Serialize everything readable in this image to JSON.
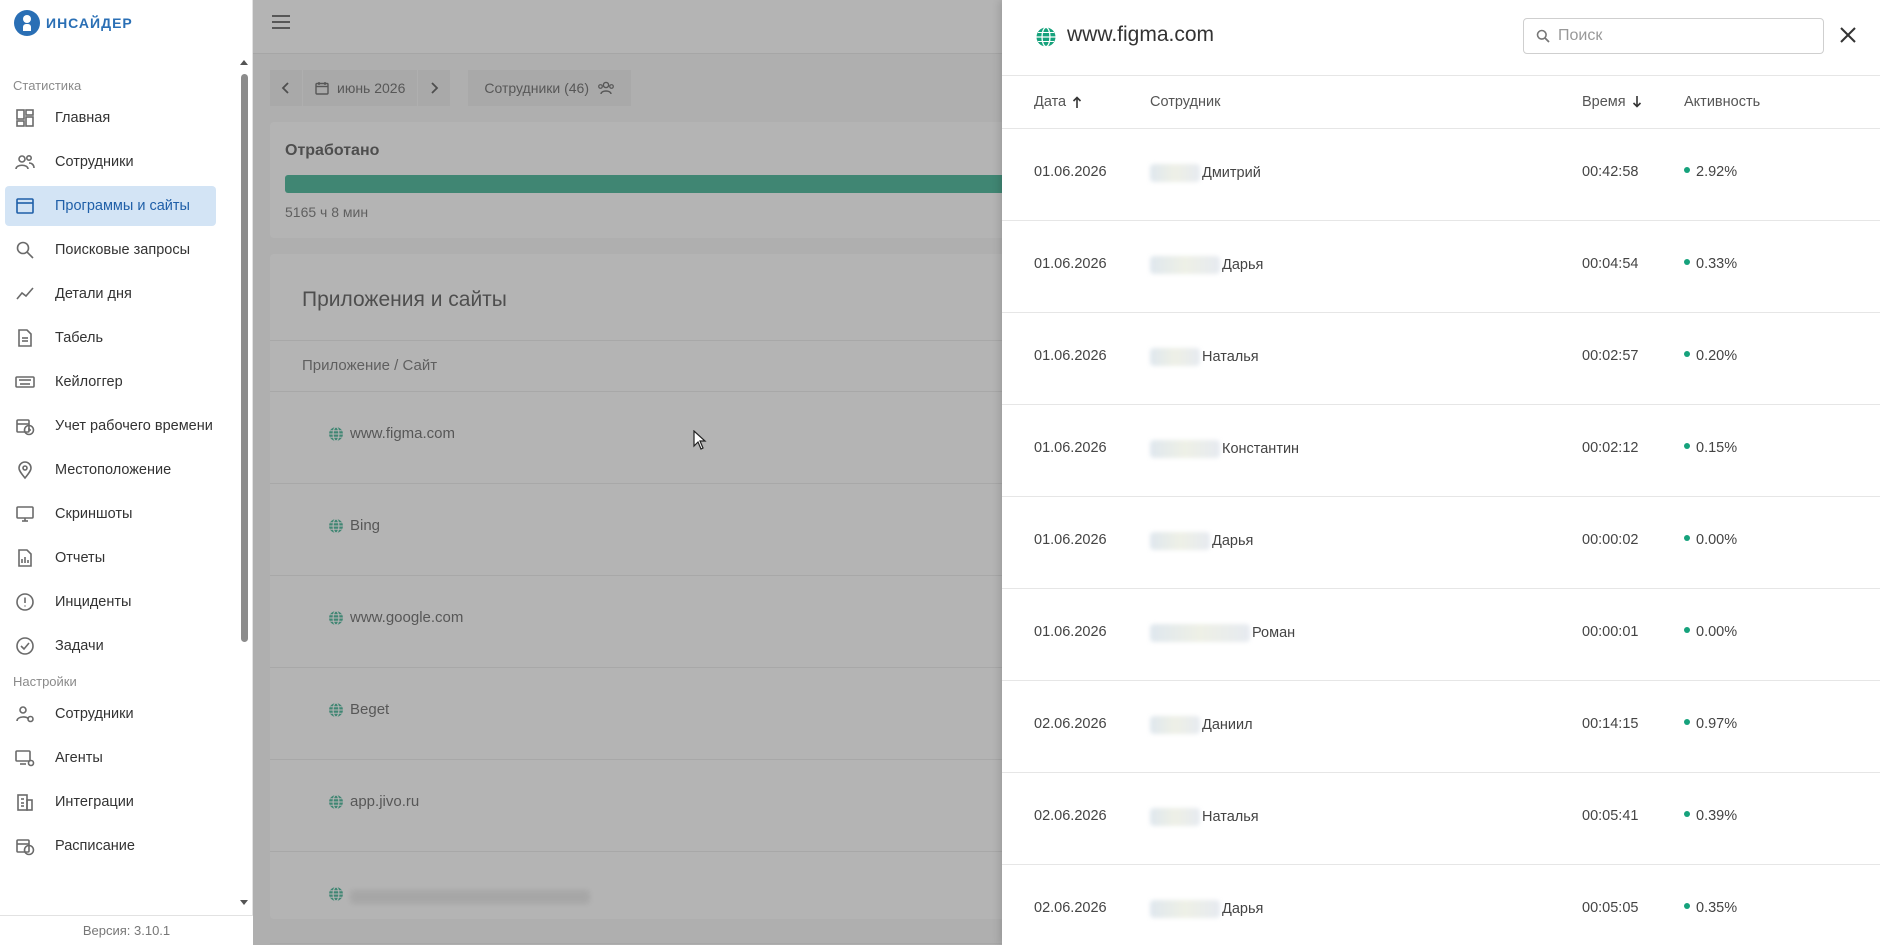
{
  "app": {
    "logo_text": "ИНСАЙДЕР",
    "version": "Версия: 3.10.1"
  },
  "sidebar": {
    "stats_section": "Статистика",
    "stats_items": [
      {
        "label": "Главная",
        "icon": "dashboard-icon"
      },
      {
        "label": "Сотрудники",
        "icon": "users-icon"
      },
      {
        "label": "Программы и сайты",
        "icon": "window-icon",
        "active": true
      },
      {
        "label": "Поисковые запросы",
        "icon": "search-icon"
      },
      {
        "label": "Детали дня",
        "icon": "chart-line-icon"
      },
      {
        "label": "Табель",
        "icon": "document-icon"
      },
      {
        "label": "Кейлоггер",
        "icon": "keyboard-icon"
      },
      {
        "label": "Учет рабочего времени",
        "icon": "calendar-clock-icon"
      },
      {
        "label": "Местоположение",
        "icon": "location-pin-icon"
      },
      {
        "label": "Скриншоты",
        "icon": "monitor-icon"
      },
      {
        "label": "Отчеты",
        "icon": "report-icon"
      },
      {
        "label": "Инциденты",
        "icon": "alert-circle-icon"
      },
      {
        "label": "Задачи",
        "icon": "check-circle-icon"
      }
    ],
    "settings_section": "Настройки",
    "settings_items": [
      {
        "label": "Сотрудники",
        "icon": "user-settings-icon"
      },
      {
        "label": "Агенты",
        "icon": "monitor-settings-icon"
      },
      {
        "label": "Интеграции",
        "icon": "building-icon"
      },
      {
        "label": "Расписание",
        "icon": "calendar-schedule-icon"
      }
    ]
  },
  "toolbar": {
    "period": "июнь 2026",
    "employees": "Сотрудники (46)"
  },
  "worked": {
    "title": "Отработано",
    "value": "5165 ч 8 мин"
  },
  "apps": {
    "title": "Приложения и сайты",
    "column": "Приложение / Сайт",
    "rows": [
      "www.figma.com",
      "Bing",
      "www.google.com",
      "Beget",
      "app.jivo.ru"
    ]
  },
  "drawer": {
    "title": "www.figma.com",
    "search_placeholder": "Поиск",
    "columns": {
      "date": "Дата",
      "employee": "Сотрудник",
      "time": "Время",
      "activity": "Активность"
    },
    "rows": [
      {
        "date": "01.06.2026",
        "employee": "Дмитрий",
        "time": "00:42:58",
        "activity": "2.92%"
      },
      {
        "date": "01.06.2026",
        "employee": "Дарья",
        "time": "00:04:54",
        "activity": "0.33%"
      },
      {
        "date": "01.06.2026",
        "employee": "Наталья",
        "time": "00:02:57",
        "activity": "0.20%"
      },
      {
        "date": "01.06.2026",
        "employee": "Константин",
        "time": "00:02:12",
        "activity": "0.15%"
      },
      {
        "date": "01.06.2026",
        "employee": "Дарья",
        "time": "00:00:02",
        "activity": "0.00%"
      },
      {
        "date": "01.06.2026",
        "employee": "Роман",
        "time": "00:00:01",
        "activity": "0.00%"
      },
      {
        "date": "02.06.2026",
        "employee": "Даниил",
        "time": "00:14:15",
        "activity": "0.97%"
      },
      {
        "date": "02.06.2026",
        "employee": "Наталья",
        "time": "00:05:41",
        "activity": "0.39%"
      },
      {
        "date": "02.06.2026",
        "employee": "Дарья",
        "time": "00:05:05",
        "activity": "0.35%"
      }
    ]
  },
  "colors": {
    "accent": "#1f5fa8",
    "progress": "#16a27c",
    "active_bg": "#d3e4f5"
  }
}
